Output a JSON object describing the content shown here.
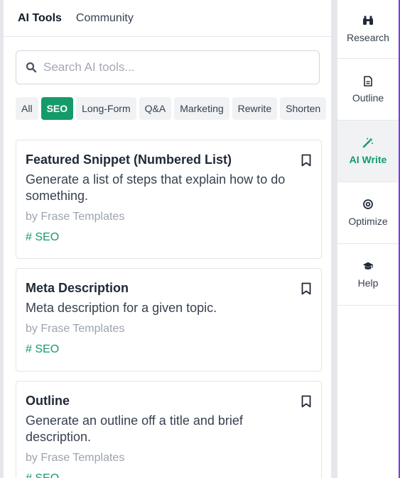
{
  "tabs": [
    {
      "label": "AI Tools",
      "active": true
    },
    {
      "label": "Community",
      "active": false
    }
  ],
  "search": {
    "placeholder": "Search AI tools...",
    "icon": "search-icon"
  },
  "filters": [
    "All",
    "SEO",
    "Long-Form",
    "Q&A",
    "Marketing",
    "Rewrite",
    "Shorten"
  ],
  "active_filter": "SEO",
  "cards": [
    {
      "title": "Featured Snippet (Numbered List)",
      "description": "Generate a list of steps that explain how to do something.",
      "author": "by Frase Templates",
      "tag": "# SEO"
    },
    {
      "title": "Meta Description",
      "description": "Meta description for a given topic.",
      "author": "by Frase Templates",
      "tag": "# SEO"
    },
    {
      "title": "Outline",
      "description": "Generate an outline off a title and brief description.",
      "author": "by Frase Templates",
      "tag": "# SEO"
    }
  ],
  "nav": [
    {
      "label": "Research",
      "icon": "binoculars-icon",
      "active": false
    },
    {
      "label": "Outline",
      "icon": "document-icon",
      "active": false
    },
    {
      "label": "AI Write",
      "icon": "magic-wand-icon",
      "active": true
    },
    {
      "label": "Optimize",
      "icon": "target-icon",
      "active": false
    },
    {
      "label": "Help",
      "icon": "graduation-cap-icon",
      "active": false
    }
  ],
  "colors": {
    "accent": "#159a6a",
    "nav_border": "#7c3aed"
  }
}
